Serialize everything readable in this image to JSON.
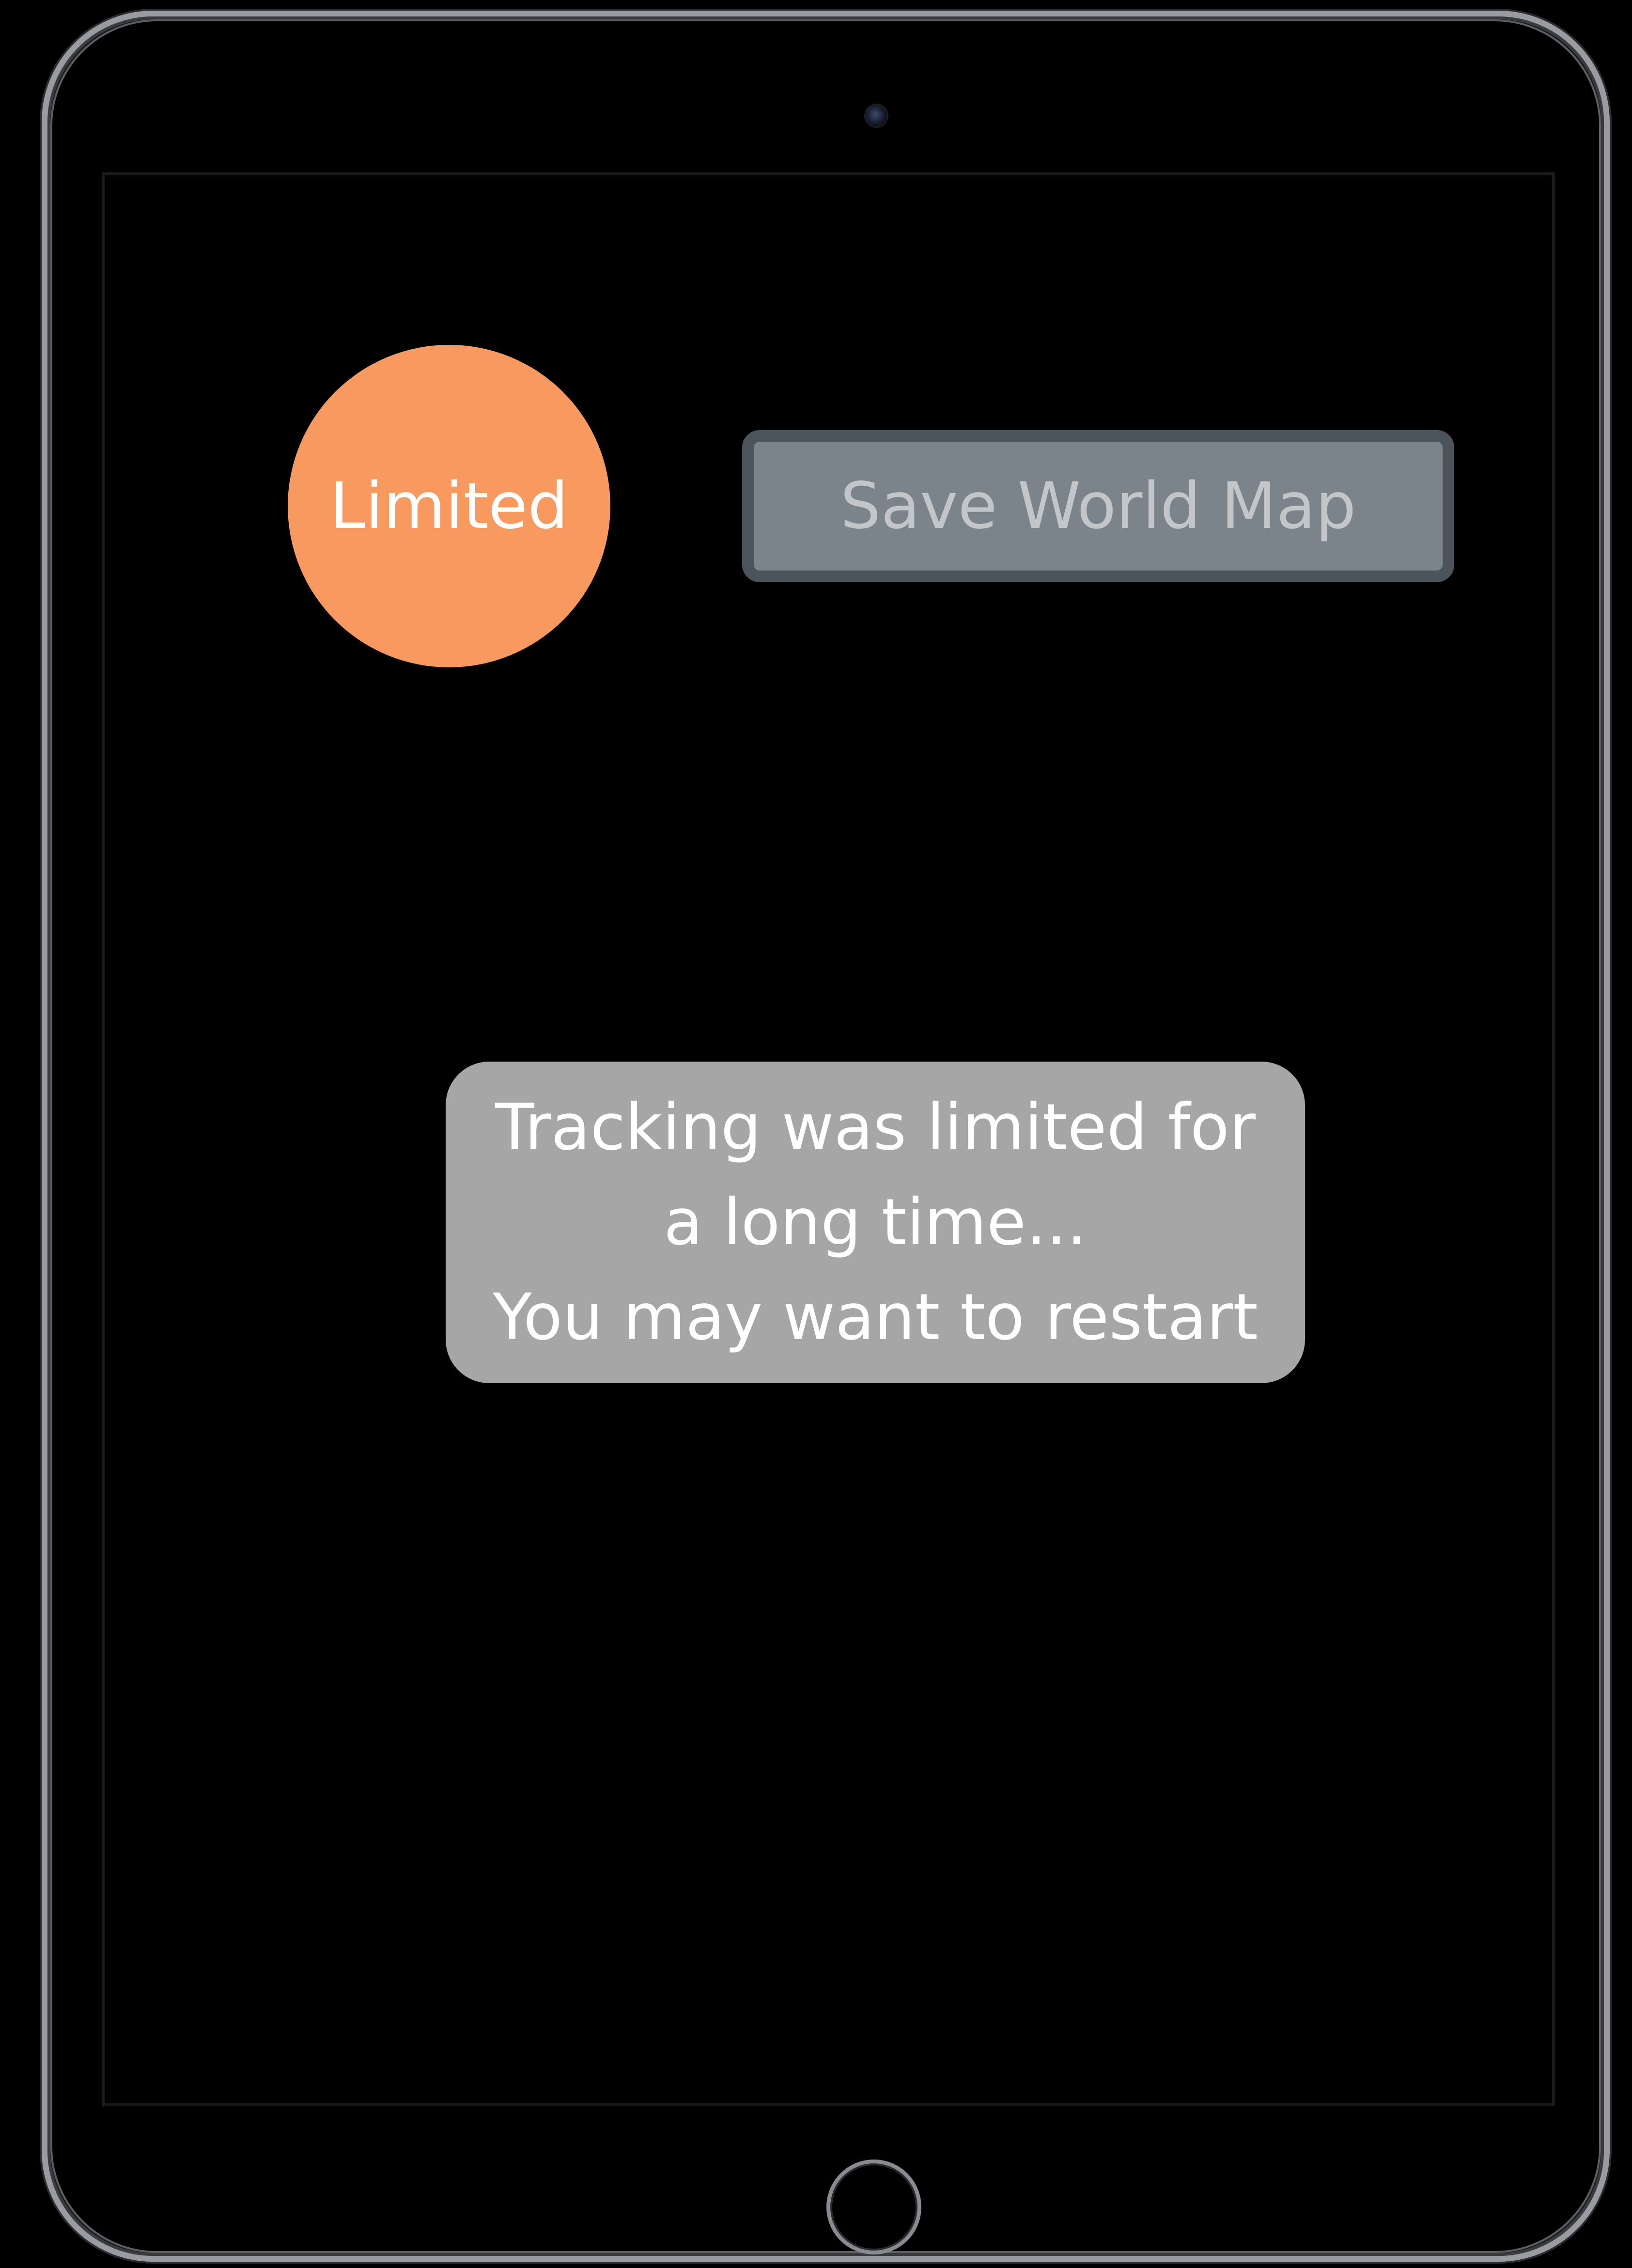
{
  "device": {
    "type": "iPad",
    "camera_icon": "front-camera-icon",
    "home_button_icon": "home-button-icon"
  },
  "screen": {
    "tracking_status": {
      "label": "Limited",
      "color": "#f89a60"
    },
    "save_world_map_button": {
      "label": "Save World Map",
      "state": "disabled"
    },
    "message": {
      "lines": [
        "Tracking was limited for",
        "a long time...",
        "You may want to restart"
      ]
    }
  }
}
